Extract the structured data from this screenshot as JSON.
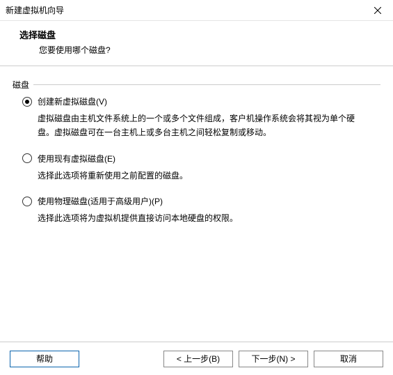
{
  "window": {
    "title": "新建虚拟机向导",
    "close_icon": "close-icon"
  },
  "header": {
    "title": "选择磁盘",
    "subtitle": "您要使用哪个磁盘?"
  },
  "fieldset": {
    "legend": "磁盘"
  },
  "options": [
    {
      "label": "创建新虚拟磁盘(V)",
      "desc": "虚拟磁盘由主机文件系统上的一个或多个文件组成，客户机操作系统会将其视为单个硬盘。虚拟磁盘可在一台主机上或多台主机之间轻松复制或移动。",
      "checked": true
    },
    {
      "label": "使用现有虚拟磁盘(E)",
      "desc": "选择此选项将重新使用之前配置的磁盘。",
      "checked": false
    },
    {
      "label": "使用物理磁盘(适用于高级用户)(P)",
      "desc": "选择此选项将为虚拟机提供直接访问本地硬盘的权限。",
      "checked": false
    }
  ],
  "footer": {
    "help": "帮助",
    "back": "< 上一步(B)",
    "next": "下一步(N) >",
    "cancel": "取消"
  }
}
